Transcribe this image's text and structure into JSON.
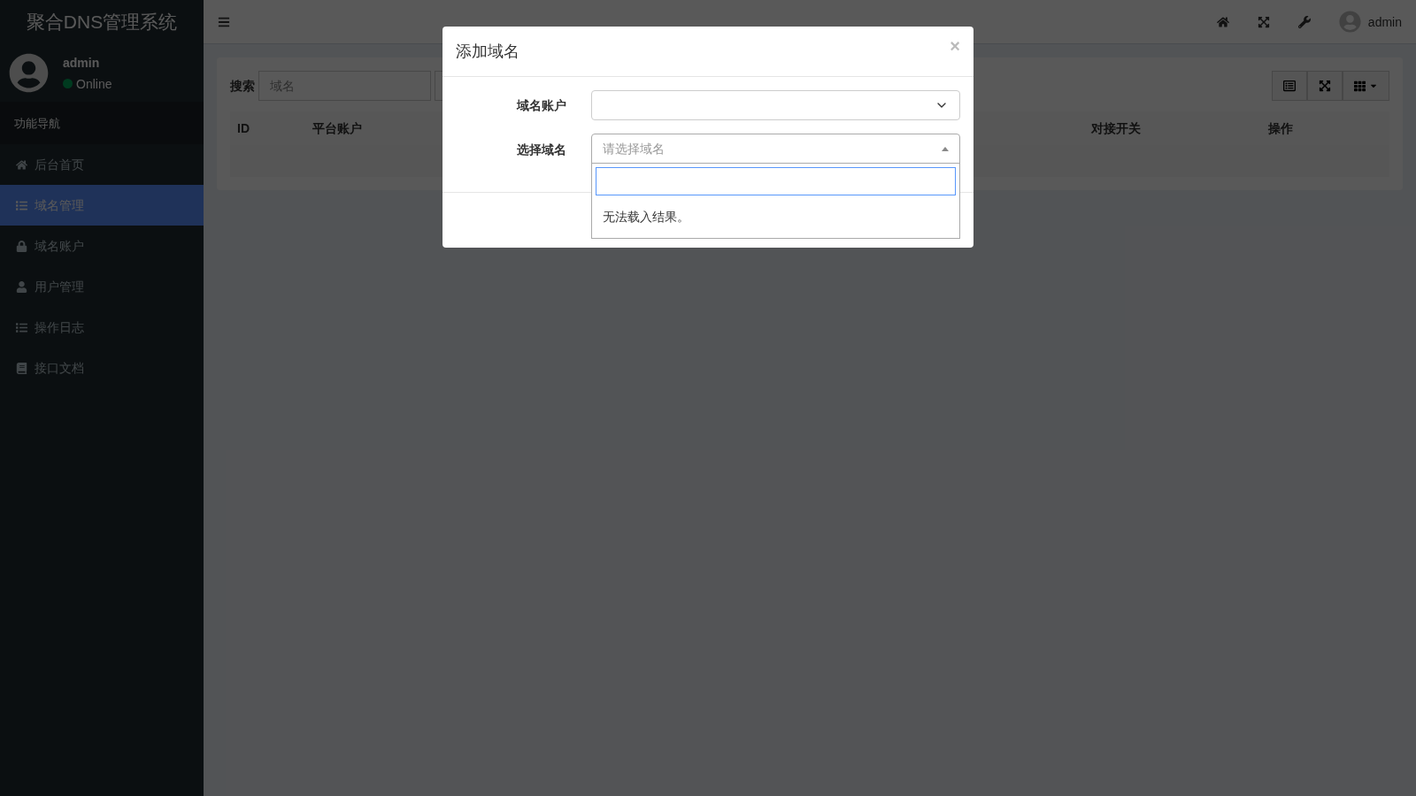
{
  "brand": "聚合DNS管理系统",
  "user_panel": {
    "name": "admin",
    "status": "Online"
  },
  "sidebar": {
    "header": "功能导航",
    "items": [
      {
        "label": "后台首页",
        "selected": false
      },
      {
        "label": "域名管理",
        "selected": true
      },
      {
        "label": "域名账户",
        "selected": false
      },
      {
        "label": "用户管理",
        "selected": false
      },
      {
        "label": "操作日志",
        "selected": false
      },
      {
        "label": "接口文档",
        "selected": false
      }
    ]
  },
  "topbar": {
    "user": "admin"
  },
  "toolbar": {
    "search_label": "搜索",
    "search_placeholder": "域名"
  },
  "table": {
    "columns": [
      "ID",
      "平台账户",
      "对接开关",
      "操作"
    ]
  },
  "modal": {
    "title": "添加域名",
    "close": "×",
    "fields": [
      {
        "label": "域名账户",
        "kind": "select"
      },
      {
        "label": "选择域名",
        "kind": "select2",
        "placeholder": "请选择域名",
        "expanded": true
      }
    ],
    "dropdown": {
      "message": "无法载入结果。"
    }
  }
}
